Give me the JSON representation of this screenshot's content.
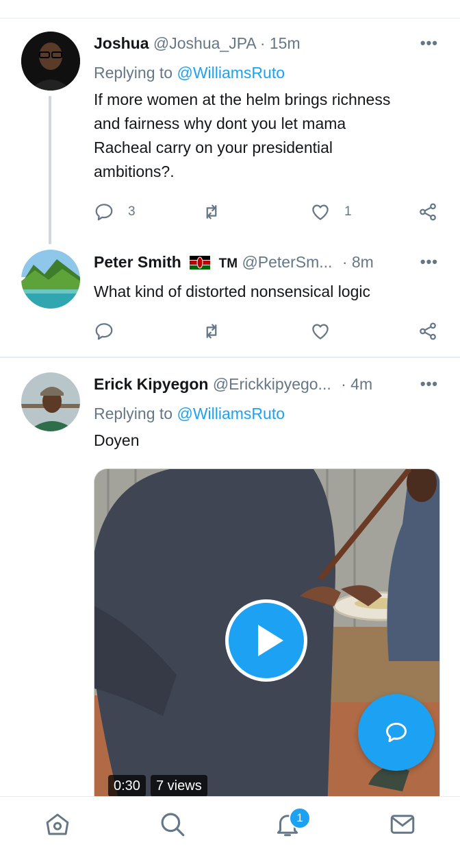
{
  "tweets": [
    {
      "name": "Joshua",
      "handle": "@Joshua_JPA",
      "time": "· 15m",
      "replying_prefix": "Replying to",
      "replying_to": "@WilliamsRuto",
      "text_lines": [
        "If more women at the helm brings richness",
        "and fairness why dont you let mama",
        "Racheal carry on your presidential",
        "ambitions?."
      ],
      "reply_count": "3",
      "like_count": "1"
    },
    {
      "name": "Peter Smith",
      "name_suffix": "TM",
      "handle": "@PeterSm...",
      "time": "· 8m",
      "text": "What kind of distorted nonsensical logic"
    },
    {
      "name": "Erick Kipyegon",
      "handle": "@Erickkipyego...",
      "time": "· 4m",
      "replying_prefix": "Replying to",
      "replying_to": "@WilliamsRuto",
      "text": "Doyen",
      "video": {
        "duration": "0:30",
        "views": "7 views"
      }
    }
  ],
  "more_label": "•••",
  "notifications_count": "1",
  "colors": {
    "accent": "#1da1f2",
    "muted": "#657786",
    "divider": "#e6ecf0"
  }
}
